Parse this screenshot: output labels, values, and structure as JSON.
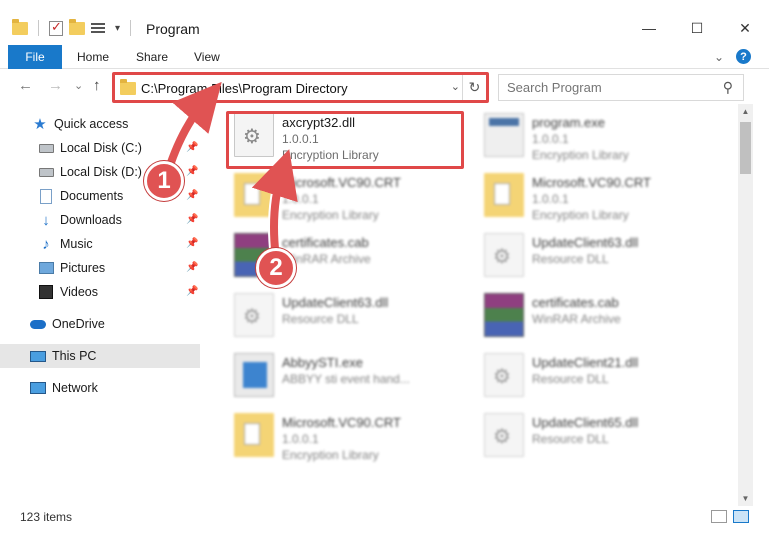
{
  "window": {
    "title": "Program",
    "controls": {
      "minimize": "—",
      "maximize": "☐",
      "close": "✕"
    }
  },
  "ribbon": {
    "tabs": [
      "File",
      "Home",
      "Share",
      "View"
    ],
    "expand": "⌄",
    "help": "?"
  },
  "nav": {
    "back": "←",
    "forward": "→",
    "recent": "⌄",
    "up": "↑",
    "address": "C:\\Program Files\\Program Directory",
    "address_drop": "⌄",
    "refresh": "↻",
    "search_placeholder": "Search Program",
    "search_icon": "⚲"
  },
  "sidebar": {
    "quick_access": "Quick access",
    "items": [
      {
        "label": "Local Disk (C:)",
        "icon": "disk-icon"
      },
      {
        "label": "Local Disk (D:)",
        "icon": "disk-icon"
      },
      {
        "label": "Documents",
        "icon": "documents-icon"
      },
      {
        "label": "Downloads",
        "icon": "download-icon"
      },
      {
        "label": "Music",
        "icon": "music-icon"
      },
      {
        "label": "Pictures",
        "icon": "pictures-icon"
      },
      {
        "label": "Videos",
        "icon": "videos-icon"
      }
    ],
    "onedrive": "OneDrive",
    "thispc": "This PC",
    "network": "Network",
    "pin_glyph": "📌"
  },
  "files": [
    {
      "name": "axcrypt32.dll",
      "line1": "1.0.0.1",
      "line2": "Encryption Library",
      "type": "dll",
      "highlighted": true
    },
    {
      "name": "program.exe",
      "line1": "1.0.0.1",
      "line2": "Encryption Library",
      "type": "prog",
      "highlighted": false
    },
    {
      "name": "Microsoft.VC90.CRT",
      "line1": "1.0.0.1",
      "line2": "Encryption Library",
      "type": "folder",
      "highlighted": false
    },
    {
      "name": "Microsoft.VC90.CRT",
      "line1": "1.0.0.1",
      "line2": "Encryption Library",
      "type": "folder",
      "highlighted": false
    },
    {
      "name": "certificates.cab",
      "line1": "WinRAR Archive",
      "line2": "",
      "type": "cab",
      "highlighted": false
    },
    {
      "name": "UpdateClient63.dll",
      "line1": "Resource DLL",
      "line2": "",
      "type": "dll",
      "highlighted": false
    },
    {
      "name": "UpdateClient63.dll",
      "line1": "Resource DLL",
      "line2": "",
      "type": "dll",
      "highlighted": false
    },
    {
      "name": "certificates.cab",
      "line1": "WinRAR Archive",
      "line2": "",
      "type": "cab",
      "highlighted": false
    },
    {
      "name": "AbbyySTI.exe",
      "line1": "ABBYY sti event hand...",
      "line2": "",
      "type": "exe",
      "highlighted": false
    },
    {
      "name": "UpdateClient21.dll",
      "line1": "Resource DLL",
      "line2": "",
      "type": "dll",
      "highlighted": false
    },
    {
      "name": "Microsoft.VC90.CRT",
      "line1": "1.0.0.1",
      "line2": "Encryption Library",
      "type": "folder",
      "highlighted": false
    },
    {
      "name": "UpdateClient65.dll",
      "line1": "Resource DLL",
      "line2": "",
      "type": "dll",
      "highlighted": false
    }
  ],
  "status": {
    "count": "123 items"
  },
  "annotations": {
    "step1": "1",
    "step2": "2",
    "color": "#e05353"
  }
}
